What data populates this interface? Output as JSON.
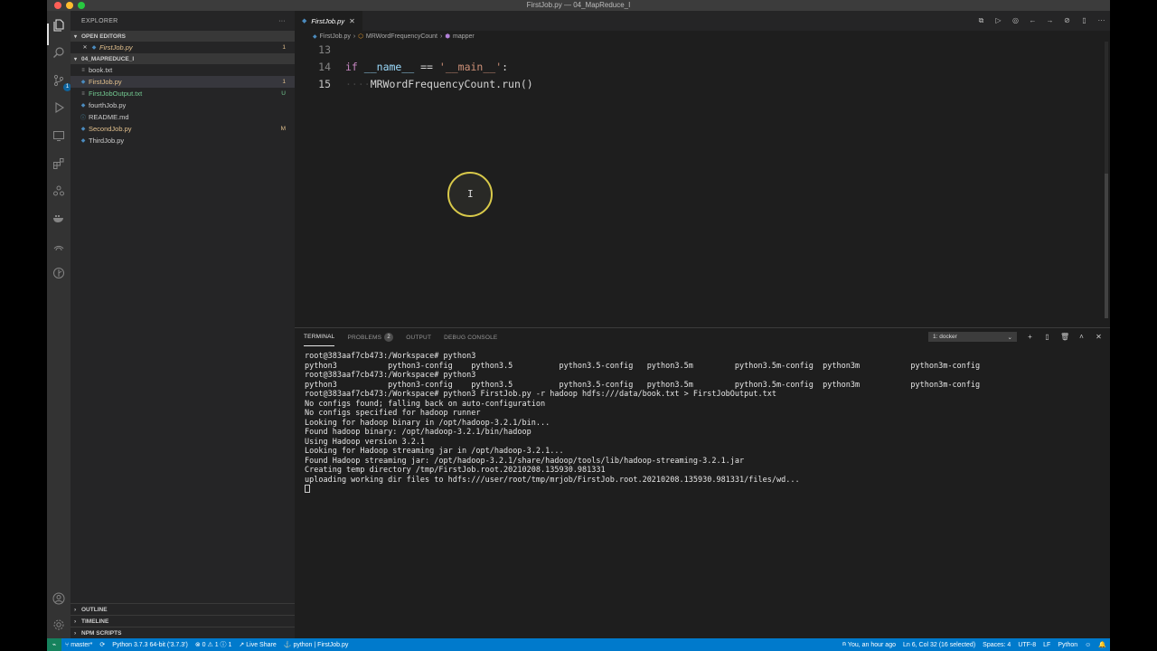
{
  "window": {
    "title": "FirstJob.py — 04_MapReduce_I"
  },
  "activity_bar": {
    "scm_badge": "1"
  },
  "sidebar": {
    "title": "EXPLORER",
    "more_icon": "ellipsis-icon",
    "open_editors_label": "OPEN EDITORS",
    "open_editors": [
      {
        "name": "FirstJob.py",
        "decoration": "1"
      }
    ],
    "folder_label": "04_MAPREDUCE_I",
    "files": [
      {
        "name": "book.txt",
        "decoration": "",
        "kind": "txt"
      },
      {
        "name": "FirstJob.py",
        "decoration": "1",
        "kind": "py"
      },
      {
        "name": "FirstJobOutput.txt",
        "decoration": "U",
        "kind": "txt"
      },
      {
        "name": "fourthJob.py",
        "decoration": "",
        "kind": "py"
      },
      {
        "name": "README.md",
        "decoration": "",
        "kind": "md"
      },
      {
        "name": "SecondJob.py",
        "decoration": "M",
        "kind": "py"
      },
      {
        "name": "ThirdJob.py",
        "decoration": "",
        "kind": "py"
      }
    ],
    "bottom_sections": [
      "OUTLINE",
      "TIMELINE",
      "NPM SCRIPTS"
    ]
  },
  "editor": {
    "tab_label": "FirstJob.py",
    "breadcrumbs": [
      "FirstJob.py",
      "MRWordFrequencyCount",
      "mapper"
    ],
    "lines": [
      {
        "num": "13"
      },
      {
        "num": "14",
        "kw": "if",
        "name": "__name__",
        "op": " == ",
        "str": "'__main__'",
        "end": ":"
      },
      {
        "num": "15",
        "indent": "····",
        "call": "MRWordFrequencyCount.run()"
      }
    ]
  },
  "panel": {
    "tabs": [
      "TERMINAL",
      "PROBLEMS",
      "OUTPUT",
      "DEBUG CONSOLE"
    ],
    "problems_count": "2",
    "terminal_select": "1: docker",
    "terminal_lines": [
      "root@383aaf7cb473:/Workspace# python3",
      "python3           python3-config    python3.5          python3.5-config   python3.5m         python3.5m-config  python3m           python3m-config",
      "root@383aaf7cb473:/Workspace# python3",
      "python3           python3-config    python3.5          python3.5-config   python3.5m         python3.5m-config  python3m           python3m-config",
      "root@383aaf7cb473:/Workspace# python3 FirstJob.py -r hadoop hdfs:///data/book.txt > FirstJobOutput.txt",
      "No configs found; falling back on auto-configuration",
      "No configs specified for hadoop runner",
      "Looking for hadoop binary in /opt/hadoop-3.2.1/bin...",
      "Found hadoop binary: /opt/hadoop-3.2.1/bin/hadoop",
      "Using Hadoop version 3.2.1",
      "Looking for Hadoop streaming jar in /opt/hadoop-3.2.1...",
      "Found Hadoop streaming jar: /opt/hadoop-3.2.1/share/hadoop/tools/lib/hadoop-streaming-3.2.1.jar",
      "Creating temp directory /tmp/FirstJob.root.20210208.135930.981331",
      "uploading working dir files to hdfs:///user/root/tmp/mrjob/FirstJob.root.20210208.135930.981331/files/wd..."
    ]
  },
  "statusbar": {
    "branch": "master*",
    "interpreter": "Python 3.7.3 64-bit ('3.7.3')",
    "problems": "⊗ 0 ⚠ 1 ⓘ 1",
    "live_share": "Live Share",
    "context": "python | FirstJob.py",
    "blame": "You, an hour ago",
    "position": "Ln 6, Col 32 (16 selected)",
    "spaces": "Spaces: 4",
    "encoding": "UTF-8",
    "eol": "LF",
    "language": "Python"
  }
}
